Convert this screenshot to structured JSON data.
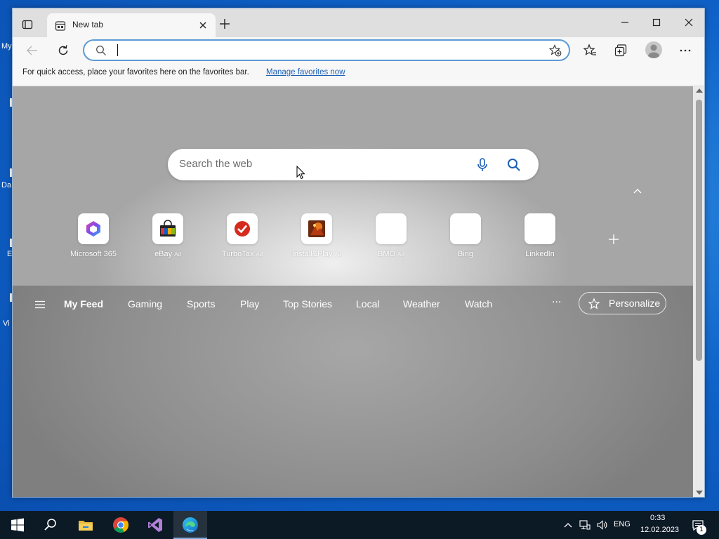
{
  "desktop": {
    "labels": [
      "My",
      "Da",
      "E",
      "Vi"
    ]
  },
  "browser": {
    "tab": {
      "title": "New tab"
    },
    "favorites_bar": {
      "text": "For quick access, place your favorites here on the favorites bar.",
      "link": "Manage favorites now"
    },
    "address_bar": {
      "value": ""
    }
  },
  "new_tab_page": {
    "search_placeholder": "Search the web",
    "tiles": [
      {
        "label": "Microsoft 365",
        "ad": ""
      },
      {
        "label": "eBay",
        "ad": "Ad"
      },
      {
        "label": "TurboTax",
        "ad": "Ad"
      },
      {
        "label": "Install&Play",
        "ad": "Ad"
      },
      {
        "label": "BMO",
        "ad": "Ad"
      },
      {
        "label": "Bing",
        "ad": ""
      },
      {
        "label": "LinkedIn",
        "ad": ""
      }
    ],
    "feed_nav": [
      "My Feed",
      "Gaming",
      "Sports",
      "Play",
      "Top Stories",
      "Local",
      "Weather",
      "Watch"
    ],
    "feed_more": "···",
    "personalize": "Personalize"
  },
  "taskbar": {
    "language": "ENG",
    "time": "0:33",
    "date": "12.02.2023",
    "notification_count": "1"
  },
  "icons": {
    "start": "windows-logo-icon",
    "search": "search-icon",
    "explorer": "folder-icon",
    "chrome": "chrome-icon",
    "visual_studio": "visual-studio-icon",
    "edge": "edge-icon"
  },
  "colors": {
    "accent": "#1a5fb4",
    "desktop": "#0f62c8",
    "taskbar": "#0c1a26"
  }
}
